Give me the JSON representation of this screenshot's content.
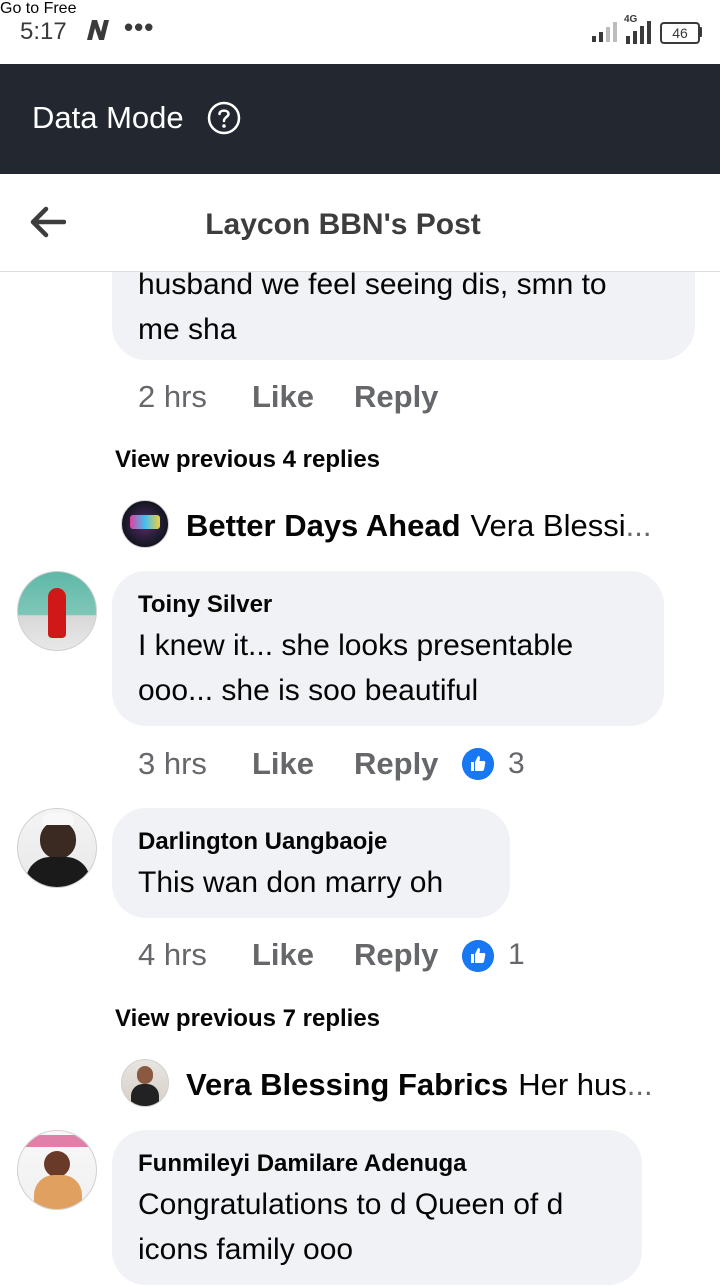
{
  "status_bar": {
    "time": "5:17",
    "dots": "•••",
    "network": "4G",
    "battery": "46"
  },
  "data_bar": {
    "label": "Data Mode",
    "button": "Go to Free"
  },
  "header": {
    "title": "Laycon BBN's Post"
  },
  "top_comment": {
    "text_line1": "husband we feel seeing dis, smn to",
    "text_line2": "me sha",
    "time": "2 hrs",
    "like": "Like",
    "reply": "Reply"
  },
  "view_prev_1": "View previous 4 replies",
  "reply_preview_1": {
    "name": "Better Days Ahead",
    "snippet": "Vera Blessi",
    "ellipsis": "..."
  },
  "comment_1": {
    "author": "Toiny Silver",
    "text_line1": "I knew it... she looks  presentable",
    "text_line2": "ooo...  she is soo beautiful",
    "time": "3 hrs",
    "like": "Like",
    "reply": "Reply",
    "reactions": "3"
  },
  "comment_2": {
    "author": "Darlington Uangbaoje",
    "text_line1": "This wan don marry oh",
    "time": "4 hrs",
    "like": "Like",
    "reply": "Reply",
    "reactions": "1"
  },
  "view_prev_2": "View previous 7 replies",
  "reply_preview_2": {
    "name": "Vera Blessing Fabrics",
    "snippet": "Her hus",
    "ellipsis": "..."
  },
  "comment_3": {
    "author": "Funmileyi Damilare Adenuga",
    "text_line1": "Congratulations to d Queen of d",
    "text_line2": "icons family ooo"
  },
  "colors": {
    "accent": "#1877f2",
    "bubble": "#f0f2f5",
    "databar": "#23272f",
    "meta": "#65676b"
  }
}
